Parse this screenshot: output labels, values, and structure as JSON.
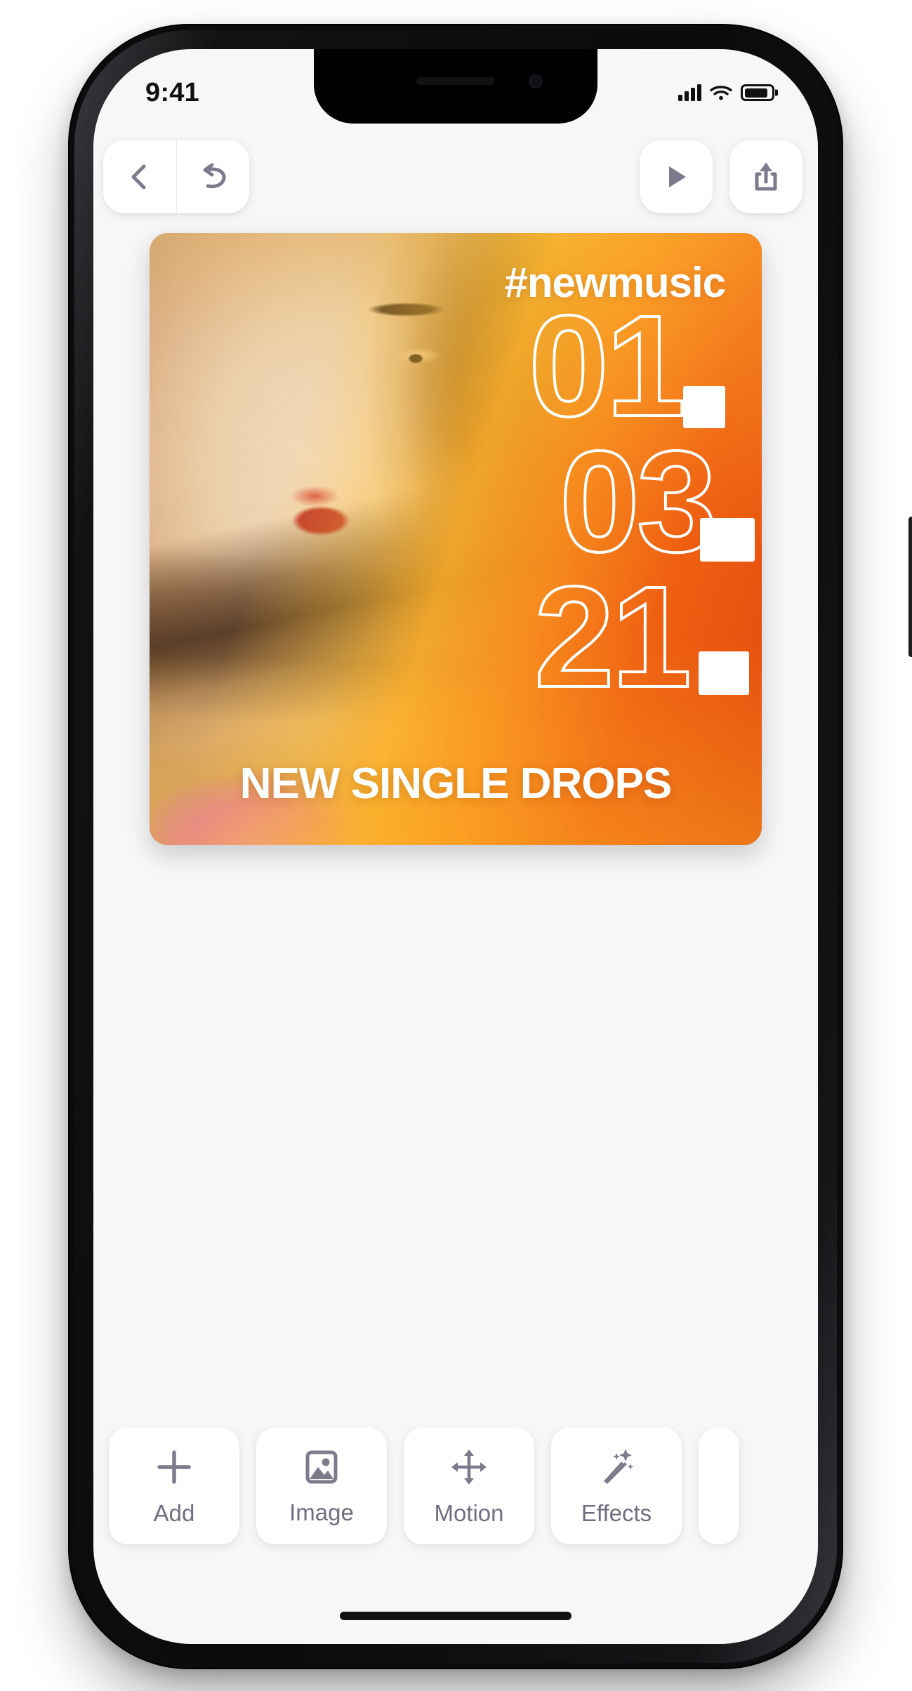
{
  "status_bar": {
    "time": "9:41",
    "signal_icon": "cellular-signal-icon",
    "wifi_icon": "wifi-icon",
    "battery_icon": "battery-icon"
  },
  "toolbar": {
    "back_label": "Back",
    "back_icon": "chevron-left-icon",
    "undo_label": "Undo",
    "undo_icon": "undo-arrow-icon",
    "play_label": "Play",
    "play_icon": "play-triangle-icon",
    "share_label": "Share",
    "share_icon": "share-up-arrow-icon"
  },
  "poster": {
    "hashtag": "#newmusic",
    "number_lines": [
      "01",
      "03",
      "21"
    ],
    "headline": "NEW SINGLE DROPS",
    "colors": {
      "gradient_start": "#ffc42e",
      "gradient_mid": "#fb8c1c",
      "gradient_end": "#e1480c",
      "text": "#ffffff"
    }
  },
  "tool_rail": {
    "items": [
      {
        "label": "Add",
        "icon": "plus-icon"
      },
      {
        "label": "Image",
        "icon": "picture-icon"
      },
      {
        "label": "Motion",
        "icon": "move-arrows-icon"
      },
      {
        "label": "Effects",
        "icon": "magic-wand-icon"
      }
    ]
  }
}
